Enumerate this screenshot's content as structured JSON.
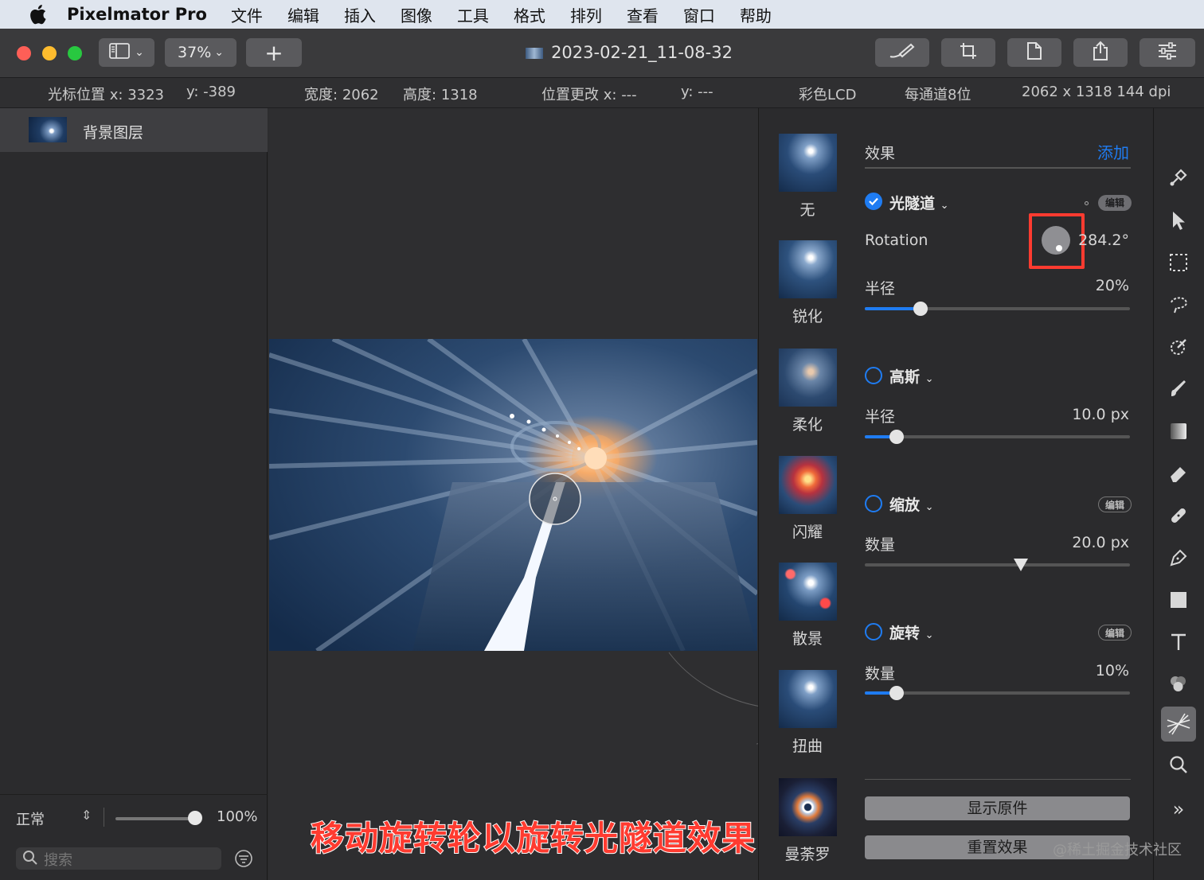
{
  "menubar": {
    "app_name": "Pixelmator Pro",
    "items": [
      "文件",
      "编辑",
      "插入",
      "图像",
      "工具",
      "格式",
      "排列",
      "查看",
      "窗口",
      "帮助"
    ]
  },
  "toolbar": {
    "zoom": "37%",
    "add_label": "+",
    "doc_title": "2023-02-21_11-08-32"
  },
  "infobar": {
    "cursor_x_label": "光标位置 x:",
    "cursor_x": "3323",
    "cursor_y_label": "y:",
    "cursor_y": "-389",
    "width_label": "宽度:",
    "width": "2062",
    "height_label": "高度:",
    "height": "1318",
    "pos_x_label": "位置更改 x:",
    "pos_x": "---",
    "pos_y_label": "y:",
    "pos_y": "---",
    "color_profile": "彩色LCD",
    "bit_depth": "每通道8位",
    "dimensions_dpi": "2062 x 1318 144 dpi"
  },
  "layers": {
    "items": [
      {
        "name": "背景图层"
      }
    ],
    "blend_mode": "正常",
    "opacity": "100%",
    "opacity_fraction": 1.0,
    "search_placeholder": "搜索"
  },
  "effect_presets": [
    {
      "label": "无"
    },
    {
      "label": "锐化"
    },
    {
      "label": "柔化"
    },
    {
      "label": "闪耀"
    },
    {
      "label": "散景"
    },
    {
      "label": "扭曲"
    },
    {
      "label": "曼荼罗"
    }
  ],
  "effects_panel": {
    "header": "效果",
    "add_label": "添加",
    "edit_label": "编辑",
    "effects": [
      {
        "name": "光隧道",
        "enabled": true,
        "params": [
          {
            "label": "Rotation",
            "value": "284.2°"
          },
          {
            "label": "半径",
            "value": "20%",
            "fraction": 0.21
          }
        ]
      },
      {
        "name": "高斯",
        "enabled": false,
        "params": [
          {
            "label": "半径",
            "value": "10.0 px",
            "fraction": 0.12
          }
        ]
      },
      {
        "name": "缩放",
        "enabled": false,
        "params": [
          {
            "label": "数量",
            "value": "20.0 px",
            "fraction": 0.59
          }
        ]
      },
      {
        "name": "旋转",
        "enabled": false,
        "params": [
          {
            "label": "数量",
            "value": "10%",
            "fraction": 0.12
          }
        ]
      }
    ],
    "show_original": "显示原件",
    "reset_effects": "重置效果"
  },
  "caption": "移动旋转轮以旋转光隧道效果",
  "watermark": "@稀土掘金技术社区",
  "colors": {
    "accent": "#1f7cf2",
    "highlight_box": "#ff3b30",
    "caption_text": "#ff3b30"
  }
}
